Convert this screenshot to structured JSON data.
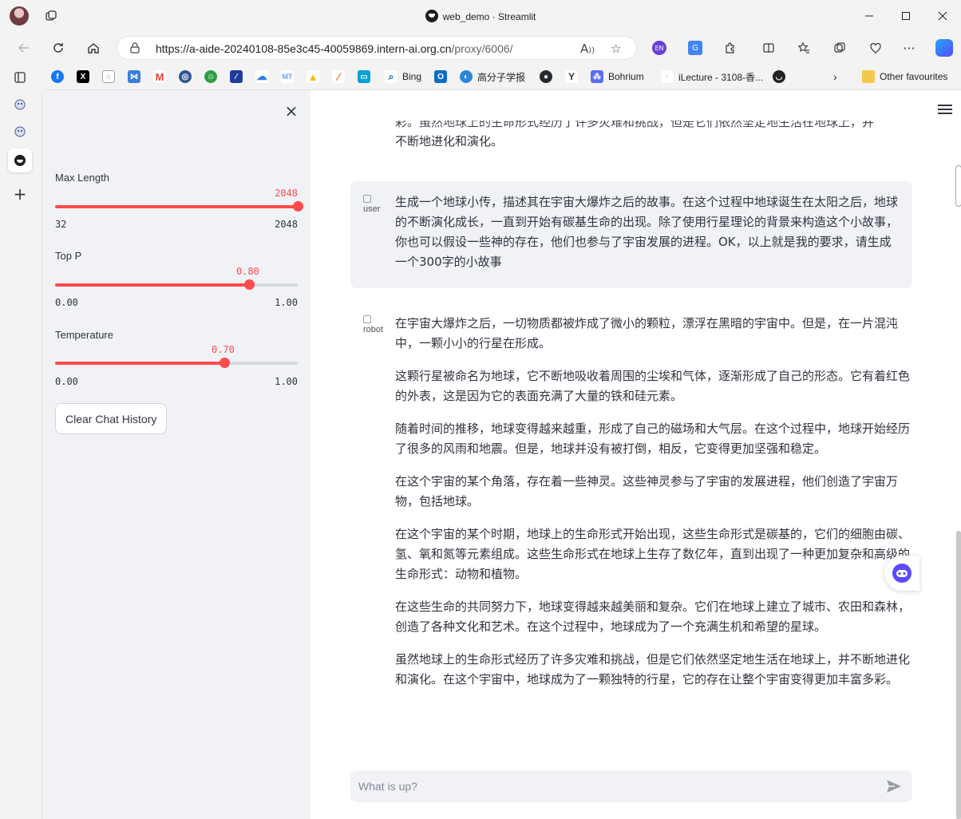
{
  "window": {
    "title": "web_demo · Streamlit"
  },
  "browser": {
    "url_main": "https://a-aide-20240108-85e3c45-40059869.intern-ai.org.cn",
    "url_path": "/proxy/6006/",
    "bookmarks": [
      {
        "label": "",
        "icon": "facebook-icon",
        "color": "#1877f2"
      },
      {
        "label": "",
        "icon": "x-icon",
        "color": "#000000"
      },
      {
        "label": "",
        "icon": "home-icon",
        "color": "#9aa0a6"
      },
      {
        "label": "",
        "icon": "m365-icon",
        "color": "#3b7ddd"
      },
      {
        "label": "",
        "icon": "gmail-icon",
        "color": "#ea4335"
      },
      {
        "label": "",
        "icon": "university-icon",
        "color": "#2f5597"
      },
      {
        "label": "",
        "icon": "bot-icon",
        "color": "#2e9e44"
      },
      {
        "label": "",
        "icon": "tiger-icon",
        "color": "#1f3c9b"
      },
      {
        "label": "",
        "icon": "cloud-icon",
        "color": "#2b7de9"
      },
      {
        "label": "",
        "icon": "mt-icon",
        "color": "#6aa4e6"
      },
      {
        "label": "",
        "icon": "drive-icon",
        "color": "#fbbc04"
      },
      {
        "label": "",
        "icon": "slash-icon",
        "color": "#e67e22"
      },
      {
        "label": "",
        "icon": "bilibili-icon",
        "color": "#00a1d6"
      },
      {
        "label": "Bing",
        "icon": "search-icon",
        "color": "#0a66c2"
      },
      {
        "label": "",
        "icon": "outlook-icon",
        "color": "#0f6cbd"
      },
      {
        "label": "高分子学报",
        "icon": "journal-icon",
        "color": "#2b88d8"
      },
      {
        "label": "",
        "icon": "github-icon",
        "color": "#24292f"
      },
      {
        "label": "",
        "icon": "y-icon",
        "color": "#333333"
      },
      {
        "label": "Bohrium",
        "icon": "bohrium-icon",
        "color": "#5b6cf9"
      },
      {
        "label": "iLecture - 3108-香...",
        "icon": "ilecture-icon",
        "color": "#bbbbbb"
      },
      {
        "label": "",
        "icon": "streamlit-icon",
        "color": "#222222"
      }
    ],
    "other_favourites": "Other favourites"
  },
  "sidebar": {
    "sliders": [
      {
        "label": "Max Length",
        "value": "2048",
        "min": "32",
        "max": "2048",
        "fraction": 1.0
      },
      {
        "label": "Top P",
        "value": "0.80",
        "min": "0.00",
        "max": "1.00",
        "fraction": 0.8
      },
      {
        "label": "Temperature",
        "value": "0.70",
        "min": "0.00",
        "max": "1.00",
        "fraction": 0.7
      }
    ],
    "clear_button": "Clear Chat History"
  },
  "chat": {
    "previous_tail_line1": "彩。虽然地球上的生命形式经历了许多灾难和挑战，但是它们依然坚定地生活在地球上，并",
    "previous_tail_line2": "不断地进化和演化。",
    "user": {
      "avatar_alt": "user",
      "text": "生成一个地球小传，描述其在宇宙大爆炸之后的故事。在这个过程中地球诞生在太阳之后，地球的不断演化成长，一直到开始有碳基生命的出现。除了使用行星理论的背景来构造这个小故事，你也可以假设一些神的存在，他们也参与了宇宙发展的进程。OK，以上就是我的要求，请生成一个300字的小故事"
    },
    "bot": {
      "avatar_alt": "robot",
      "paragraphs": [
        "在宇宙大爆炸之后，一切物质都被炸成了微小的颗粒，漂浮在黑暗的宇宙中。但是，在一片混沌中，一颗小小的行星在形成。",
        "这颗行星被命名为地球，它不断地吸收着周围的尘埃和气体，逐渐形成了自己的形态。它有着红色的外表，这是因为它的表面充满了大量的铁和硅元素。",
        "随着时间的推移，地球变得越来越重，形成了自己的磁场和大气层。在这个过程中，地球开始经历了很多的风雨和地震。但是，地球并没有被打倒，相反，它变得更加坚强和稳定。",
        "在这个宇宙的某个角落，存在着一些神灵。这些神灵参与了宇宙的发展进程，他们创造了宇宙万物，包括地球。",
        "在这个宇宙的某个时期，地球上的生命形式开始出现，这些生命形式是碳基的，它们的细胞由碳、氢、氧和氮等元素组成。这些生命形式在地球上生存了数亿年，直到出现了一种更加复杂和高级的生命形式：动物和植物。",
        "在这些生命的共同努力下，地球变得越来越美丽和复杂。它们在地球上建立了城市、农田和森林，创造了各种文化和艺术。在这个过程中，地球成为了一个充满生机和希望的星球。",
        "虽然地球上的生命形式经历了许多灾难和挑战，但是它们依然坚定地生活在地球上，并不断地进化和演化。在这个宇宙中，地球成为了一颗独特的行星，它的存在让整个宇宙变得更加丰富多彩。"
      ]
    },
    "input_placeholder": "What is up?"
  },
  "colors": {
    "accent": "#ff4b4b",
    "sidebar_bg": "#f0f2f6",
    "text": "#31333f"
  }
}
